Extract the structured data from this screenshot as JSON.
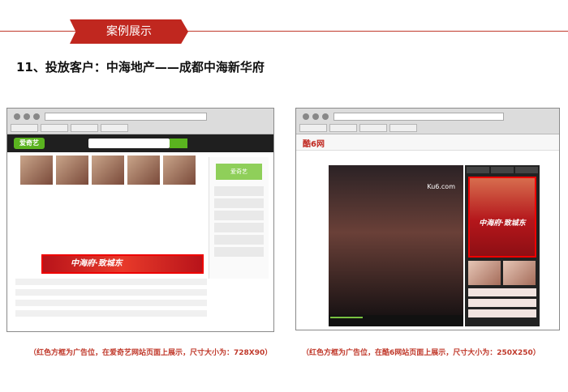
{
  "header": {
    "banner_label": "案例展示",
    "section_heading": "11、投放客户：中海地产——成都中海新华府"
  },
  "left_screenshot": {
    "site_logo": "爱奇艺",
    "sidebar_logo": "爱奇艺",
    "ad_text": "中海府·致城东",
    "caption": "（红色方框为广告位，在爱奇艺网站页面上展示，尺寸大小为：728X90）"
  },
  "right_screenshot": {
    "site_logo": "酷6网",
    "video_watermark": "Ku6.com",
    "ad_text": "中海府·致城东",
    "caption": "（红色方框为广告位，在酷6网站页面上展示，尺寸大小为：250X250）"
  },
  "colors": {
    "accent_red": "#c0271f",
    "caption_red": "#c0392b"
  }
}
